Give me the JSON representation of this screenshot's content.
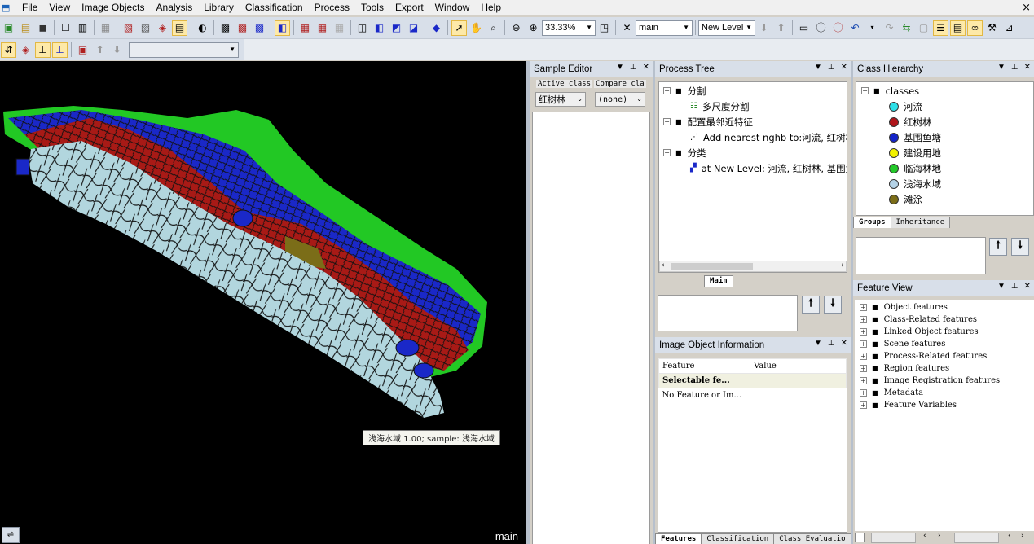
{
  "menubar": {
    "items": [
      "File",
      "View",
      "Image Objects",
      "Analysis",
      "Library",
      "Classification",
      "Process",
      "Tools",
      "Export",
      "Window",
      "Help"
    ],
    "close_glyph": "×"
  },
  "toolbar": {
    "zoom_value": "33.33%",
    "map_value": "main",
    "level_value": "New Level",
    "level_filter_value": ""
  },
  "image_view": {
    "tooltip": "浅海水域 1.00;  sample: 浅海水域",
    "map_label": "main"
  },
  "sample_editor": {
    "title": "Sample Editor",
    "active_class_label": "Active class",
    "compare_class_label": "Compare cla",
    "active_class_value": "红树林",
    "compare_class_value": "(none)"
  },
  "process_tree": {
    "title": "Process Tree",
    "nodes": [
      {
        "label": "分割",
        "level": 0,
        "icon": "folder"
      },
      {
        "label": "多尺度分割",
        "level": 1,
        "icon": "segmentation"
      },
      {
        "label": "配置最邻近特征",
        "level": 0,
        "icon": "folder"
      },
      {
        "label": "Add nearest nghb to:河流, 红树林",
        "level": 1,
        "icon": "nearest-neighbor"
      },
      {
        "label": "分类",
        "level": 0,
        "icon": "folder"
      },
      {
        "label": "at  New Level: 河流, 红树林, 基围鱼",
        "level": 1,
        "icon": "classification"
      }
    ],
    "tab": "Main"
  },
  "class_hierarchy": {
    "title": "Class Hierarchy",
    "root": "classes",
    "classes": [
      {
        "name": "河流",
        "color": "#2fe0e8"
      },
      {
        "name": "红树林",
        "color": "#b0151a"
      },
      {
        "name": "基围鱼塘",
        "color": "#1424c8"
      },
      {
        "name": "建设用地",
        "color": "#f2f200"
      },
      {
        "name": "临海林地",
        "color": "#24c82a"
      },
      {
        "name": "浅海水域",
        "color": "#b4d2e6"
      },
      {
        "name": "滩涂",
        "color": "#7b6d18"
      }
    ],
    "tabs": [
      "Groups",
      "Inheritance"
    ]
  },
  "feature_view": {
    "title": "Feature View",
    "items": [
      "Object features",
      "Class-Related features",
      "Linked Object features",
      "Scene features",
      "Process-Related features",
      "Region features",
      "Image Registration features",
      "Metadata",
      "Feature Variables"
    ]
  },
  "image_object_info": {
    "title": "Image Object Information",
    "columns": [
      "Feature",
      "Value"
    ],
    "rows": [
      "Selectable fe...",
      "No Feature or Im..."
    ],
    "tabs": [
      "Features",
      "Classification",
      "Class Evaluatio"
    ]
  },
  "colors": {
    "toolbar_bg": "#d8dfe9",
    "selection_bg": "#f0f0e0",
    "water": "#b2d6de",
    "mangrove": "#a81a16",
    "pond": "#1a28c8",
    "forest": "#22c824"
  }
}
